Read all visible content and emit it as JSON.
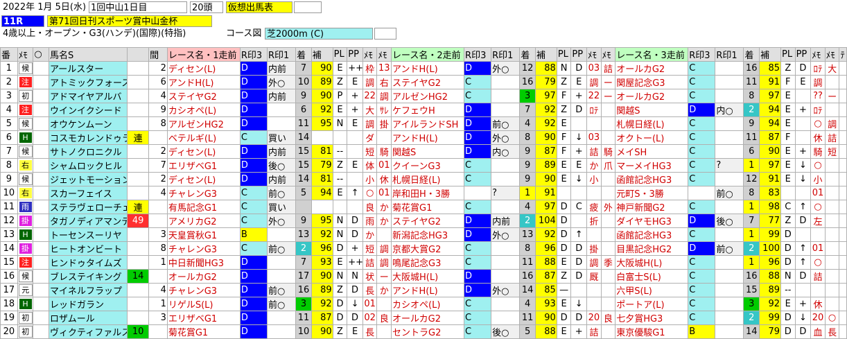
{
  "header": {
    "date": "2022年 1月 5日(水)",
    "meeting": "1回中山1日目",
    "heads": "20頭",
    "doc_type": "仮想出馬表",
    "race_no": "11R",
    "race_name": "第71回日刊スポーツ賞中山金杯",
    "conditions": "4歳以上・オープン・G3(ハンデ)(国際)(特指)",
    "course_label": "コース図",
    "course": "芝2000m (C)"
  },
  "columns": [
    "番",
    "ﾒﾓ",
    "○",
    "馬名S",
    "",
    "間",
    "レース名・1走前",
    "R印3",
    "R印1",
    "着",
    "補",
    "PL",
    "PP",
    "ﾒﾓ",
    "ﾒﾓ",
    "レース名・2走前",
    "R印3",
    "R印1",
    "着",
    "補",
    "PL",
    "PP",
    "ﾒﾓ",
    "ﾒﾓ",
    "レース名・3走前",
    "R印3",
    "R印1",
    "着",
    "補",
    "PL",
    "PP",
    "ﾒﾓ",
    "ﾒﾓ",
    "ﾃ"
  ],
  "rows": [
    {
      "no": "1",
      "mark": "候",
      "name": "アールスター",
      "tag": "",
      "gap": "2",
      "r1": {
        "name": "ディセン(L)",
        "r3": "D",
        "r1": "内前",
        "pos": "7",
        "ho": "90",
        "pl": "E",
        "pp": "++",
        "m1": "枠",
        "m2": "13"
      },
      "r2": {
        "name": "アンドH(L)",
        "r3": "D",
        "r1": "外○",
        "pos": "12",
        "ho": "88",
        "pl": "N",
        "pp": "D",
        "m1": "03",
        "m2": "詰"
      },
      "r3": {
        "name": "オールカG2",
        "r3": "C",
        "r1": "",
        "pos": "16",
        "ho": "85",
        "pl": "Z",
        "pp": "D",
        "m1": "ﾛﾃ",
        "m2": "大"
      }
    },
    {
      "no": "2",
      "mark": "注",
      "name": "アトミックフォース",
      "tag": "",
      "gap": "6",
      "r1": {
        "name": "アンドH(L)",
        "r3": "D",
        "r1": "外○",
        "pos": "10",
        "ho": "89",
        "pl": "Z",
        "pp": "E",
        "m1": "調",
        "m2": "右"
      },
      "r2": {
        "name": "ステイヤG2",
        "r3": "C",
        "r1": "",
        "pos": "16",
        "ho": "79",
        "pl": "Z",
        "pp": "E",
        "m1": "調",
        "m2": "ー"
      },
      "r3": {
        "name": "関屋記念G3",
        "r3": "C",
        "r1": "",
        "pos": "11",
        "ho": "91",
        "pl": "F",
        "pp": "E",
        "m1": "調",
        "m2": ""
      }
    },
    {
      "no": "3",
      "mark": "初",
      "name": "アドマイヤアルバ",
      "tag": "",
      "gap": "4",
      "r1": {
        "name": "ステイヤG2",
        "r3": "D",
        "r1": "内前",
        "pos": "9",
        "ho": "90",
        "pl": "P",
        "pp": "+",
        "m1": "22",
        "m2": "調"
      },
      "r2": {
        "name": "アルゼンHG2",
        "r3": "C",
        "r1": "",
        "pos": "3",
        "ho": "97",
        "pl": "F",
        "pp": "+",
        "m1": "22",
        "m2": "ー"
      },
      "r3": {
        "name": "オールカG2",
        "r3": "C",
        "r1": "",
        "pos": "8",
        "ho": "97",
        "pl": "E",
        "pp": "",
        "m1": "??",
        "m2": "ー"
      }
    },
    {
      "no": "4",
      "mark": "注",
      "name": "ウインイクシード",
      "tag": "",
      "gap": "9",
      "r1": {
        "name": "カシオペ(L)",
        "r3": "D",
        "r1": "",
        "pos": "6",
        "ho": "92",
        "pl": "E",
        "pp": "+",
        "m1": "大",
        "m2": "ｻﾚ"
      },
      "r2": {
        "name": "ケフェウH",
        "r3": "D",
        "r1": "",
        "pos": "7",
        "ho": "92",
        "pl": "Z",
        "pp": "D",
        "m1": "ﾛﾃ",
        "m2": ""
      },
      "r3": {
        "name": "関越S",
        "r3": "D",
        "r1": "内○",
        "pos": "2",
        "ho": "94",
        "pl": "E",
        "pp": "+",
        "m1": "ﾛﾃ",
        "m2": ""
      }
    },
    {
      "no": "5",
      "mark": "候",
      "name": "オウケンムーン",
      "tag": "",
      "gap": "8",
      "r1": {
        "name": "アルゼンHG2",
        "r3": "D",
        "r1": "",
        "pos": "11",
        "ho": "95",
        "pl": "N",
        "pp": "E",
        "m1": "調",
        "m2": "掛"
      },
      "r2": {
        "name": "アイルランドSH",
        "r3": "D",
        "r1": "前○",
        "pos": "4",
        "ho": "92",
        "pl": "E",
        "pp": "",
        "m1": "",
        "m2": ""
      },
      "r3": {
        "name": "札幌日経(L)",
        "r3": "C",
        "r1": "",
        "pos": "9",
        "ho": "94",
        "pl": "E",
        "pp": "",
        "m1": "○",
        "m2": "調"
      }
    },
    {
      "no": "6",
      "mark": "H",
      "name": "コスモカレンドゥラ",
      "tag": "連",
      "gap": "",
      "r1": {
        "name": "ベテルギ(L)",
        "r3": "C",
        "r1": "買い",
        "pos": "14",
        "ho": "",
        "pl": "",
        "pp": "",
        "m1": "ダ",
        "m2": ""
      },
      "r2": {
        "name": "アンドH(L)",
        "r3": "D",
        "r1": "外○",
        "pos": "8",
        "ho": "90",
        "pl": "F",
        "pp": "↓",
        "m1": "03",
        "m2": ""
      },
      "r3": {
        "name": "オクトー(L)",
        "r3": "C",
        "r1": "",
        "pos": "11",
        "ho": "87",
        "pl": "F",
        "pp": "",
        "m1": "休",
        "m2": "詰"
      }
    },
    {
      "no": "7",
      "mark": "候",
      "name": "サトノクロニクル",
      "tag": "",
      "gap": "2",
      "r1": {
        "name": "ディセン(L)",
        "r3": "D",
        "r1": "内前",
        "pos": "15",
        "ho": "81",
        "pl": "--",
        "pp": "",
        "m1": "短",
        "m2": "騎"
      },
      "r2": {
        "name": "関越S",
        "r3": "D",
        "r1": "内○",
        "pos": "9",
        "ho": "87",
        "pl": "F",
        "pp": "+",
        "m1": "詰",
        "m2": "騎"
      },
      "r3": {
        "name": "メイSH",
        "r3": "C",
        "r1": "",
        "pos": "6",
        "ho": "90",
        "pl": "E",
        "pp": "+",
        "m1": "騎",
        "m2": "短"
      }
    },
    {
      "no": "8",
      "mark": "右",
      "name": "シャムロックヒル",
      "tag": "",
      "gap": "7",
      "r1": {
        "name": "エリザベG1",
        "r3": "D",
        "r1": "後○",
        "pos": "15",
        "ho": "79",
        "pl": "Z",
        "pp": "E",
        "m1": "体",
        "m2": "01"
      },
      "r2": {
        "name": "クイーンG3",
        "r3": "C",
        "r1": "",
        "pos": "9",
        "ho": "89",
        "pl": "E",
        "pp": "E",
        "m1": "か",
        "m2": "爪"
      },
      "r3": {
        "name": "マーメイHG3",
        "r3": "C",
        "r1": "?",
        "pos": "1",
        "ho": "97",
        "pl": "E",
        "pp": "↓",
        "m1": "○",
        "m2": ""
      }
    },
    {
      "no": "9",
      "mark": "候",
      "name": "ジェットモーション",
      "tag": "",
      "gap": "2",
      "r1": {
        "name": "ディセン(L)",
        "r3": "D",
        "r1": "内前",
        "pos": "14",
        "ho": "81",
        "pl": "--",
        "pp": "",
        "m1": "小",
        "m2": "休"
      },
      "r2": {
        "name": "札幌日経(L)",
        "r3": "C",
        "r1": "",
        "pos": "9",
        "ho": "90",
        "pl": "E",
        "pp": "↓",
        "m1": "小",
        "m2": ""
      },
      "r3": {
        "name": "函館記念HG3",
        "r3": "C",
        "r1": "",
        "pos": "12",
        "ho": "91",
        "pl": "E",
        "pp": "↓",
        "m1": "小",
        "m2": ""
      }
    },
    {
      "no": "10",
      "mark": "右",
      "name": "スカーフェイス",
      "tag": "",
      "gap": "4",
      "r1": {
        "name": "チャレンG3",
        "r3": "C",
        "r1": "前○",
        "pos": "5",
        "ho": "94",
        "pl": "E",
        "pp": "↑",
        "m1": "○",
        "m2": "01"
      },
      "r2": {
        "name": "岸和田H・3勝",
        "r3": "",
        "r1": "?",
        "pos": "1",
        "ho": "91",
        "pl": "",
        "pp": "",
        "m1": "",
        "m2": ""
      },
      "r3": {
        "name": "元町S・3勝",
        "r3": "",
        "r1": "前○",
        "pos": "8",
        "ho": "83",
        "pl": "",
        "pp": "",
        "m1": "01",
        "m2": ""
      }
    },
    {
      "no": "11",
      "mark": "雨",
      "name": "ステラヴェローチェ",
      "tag": "連",
      "gap": "",
      "r1": {
        "name": "有馬記念G1",
        "r3": "C",
        "r1": "買い",
        "pos": "",
        "ho": "",
        "pl": "",
        "pp": "",
        "m1": "良",
        "m2": "か"
      },
      "r2": {
        "name": "菊花賞G1",
        "r3": "C",
        "r1": "",
        "pos": "4",
        "ho": "97",
        "pl": "D",
        "pp": "C",
        "m1": "疲",
        "m2": "外"
      },
      "r3": {
        "name": "神戸新聞G2",
        "r3": "C",
        "r1": "",
        "pos": "1",
        "ho": "98",
        "pl": "C",
        "pp": "↑",
        "m1": "○",
        "m2": ""
      }
    },
    {
      "no": "12",
      "mark": "掛",
      "name": "タガノディアマンテ",
      "tag": "49",
      "gap": "",
      "r1": {
        "name": "アメリカG2",
        "r3": "C",
        "r1": "外○",
        "pos": "9",
        "ho": "95",
        "pl": "N",
        "pp": "D",
        "m1": "雨",
        "m2": "か"
      },
      "r2": {
        "name": "ステイヤG2",
        "r3": "D",
        "r1": "内前",
        "pos": "2",
        "ho": "104",
        "pl": "D",
        "pp": "",
        "m1": "折",
        "m2": ""
      },
      "r3": {
        "name": "ダイヤモHG3",
        "r3": "D",
        "r1": "後○",
        "pos": "7",
        "ho": "77",
        "pl": "Z",
        "pp": "D",
        "m1": "左",
        "m2": ""
      }
    },
    {
      "no": "13",
      "mark": "H",
      "name": "トーセンスーリヤ",
      "tag": "",
      "gap": "3",
      "r1": {
        "name": "天皇賞秋G1",
        "r3": "B",
        "r1": "",
        "pos": "13",
        "ho": "92",
        "pl": "N",
        "pp": "D",
        "m1": "か",
        "m2": ""
      },
      "r2": {
        "name": "新潟記念HG3",
        "r3": "D",
        "r1": "外○",
        "pos": "13",
        "ho": "92",
        "pl": "D",
        "pp": "↑",
        "m1": "",
        "m2": ""
      },
      "r3": {
        "name": "函館記念HG3",
        "r3": "C",
        "r1": "",
        "pos": "1",
        "ho": "99",
        "pl": "D",
        "pp": "",
        "m1": "",
        "m2": ""
      }
    },
    {
      "no": "14",
      "mark": "掛",
      "name": "ヒートオンビート",
      "tag": "",
      "gap": "8",
      "r1": {
        "name": "チャレンG3",
        "r3": "C",
        "r1": "前○",
        "pos": "2",
        "ho": "96",
        "pl": "D",
        "pp": "+",
        "m1": "短",
        "m2": "調"
      },
      "r2": {
        "name": "京都大賞G2",
        "r3": "C",
        "r1": "",
        "pos": "8",
        "ho": "96",
        "pl": "D",
        "pp": "D",
        "m1": "掛",
        "m2": ""
      },
      "r3": {
        "name": "目黒記念HG2",
        "r3": "D",
        "r1": "前○",
        "pos": "2",
        "ho": "100",
        "pl": "D",
        "pp": "↑",
        "m1": "01",
        "m2": ""
      }
    },
    {
      "no": "15",
      "mark": "注",
      "name": "ヒンドゥタイムズ",
      "tag": "",
      "gap": "1",
      "r1": {
        "name": "中日新聞HG3",
        "r3": "D",
        "r1": "",
        "pos": "7",
        "ho": "93",
        "pl": "E",
        "pp": "++",
        "m1": "詰",
        "m2": "調"
      },
      "r2": {
        "name": "鳴尾記念G3",
        "r3": "C",
        "r1": "",
        "pos": "11",
        "ho": "88",
        "pl": "E",
        "pp": "D",
        "m1": "調",
        "m2": "季"
      },
      "r3": {
        "name": "大阪城H(L)",
        "r3": "C",
        "r1": "",
        "pos": "1",
        "ho": "96",
        "pl": "D",
        "pp": "↑",
        "m1": "○",
        "m2": ""
      }
    },
    {
      "no": "16",
      "mark": "候",
      "name": "ブレステイキング",
      "tag": "14",
      "gap": "",
      "r1": {
        "name": "オールカG2",
        "r3": "D",
        "r1": "",
        "pos": "17",
        "ho": "90",
        "pl": "N",
        "pp": "N",
        "m1": "状",
        "m2": "ー"
      },
      "r2": {
        "name": "大阪城H(L)",
        "r3": "D",
        "r1": "",
        "pos": "16",
        "ho": "87",
        "pl": "Z",
        "pp": "D",
        "m1": "厩",
        "m2": ""
      },
      "r3": {
        "name": "白富士S(L)",
        "r3": "C",
        "r1": "",
        "pos": "16",
        "ho": "88",
        "pl": "N",
        "pp": "D",
        "m1": "詰",
        "m2": ""
      }
    },
    {
      "no": "17",
      "mark": "元",
      "name": "マイネルフラップ",
      "tag": "",
      "gap": "4",
      "r1": {
        "name": "チャレンG3",
        "r3": "D",
        "r1": "前○",
        "pos": "16",
        "ho": "89",
        "pl": "Z",
        "pp": "D",
        "m1": "長",
        "m2": "か"
      },
      "r2": {
        "name": "アンドH(L)",
        "r3": "D",
        "r1": "外○",
        "pos": "14",
        "ho": "85",
        "pl": "—",
        "pp": "",
        "m1": "",
        "m2": ""
      },
      "r3": {
        "name": "六甲S(L)",
        "r3": "C",
        "r1": "",
        "pos": "15",
        "ho": "89",
        "pl": "--",
        "pp": "",
        "m1": "",
        "m2": ""
      }
    },
    {
      "no": "18",
      "mark": "H",
      "name": "レッドガラン",
      "tag": "",
      "gap": "1",
      "r1": {
        "name": "リゲルS(L)",
        "r3": "D",
        "r1": "前○",
        "pos": "3",
        "ho": "92",
        "pl": "D",
        "pp": "↓",
        "m1": "01",
        "m2": ""
      },
      "r2": {
        "name": "カシオペ(L)",
        "r3": "C",
        "r1": "",
        "pos": "4",
        "ho": "93",
        "pl": "E",
        "pp": "↓",
        "m1": "",
        "m2": ""
      },
      "r3": {
        "name": "ポートア(L)",
        "r3": "C",
        "r1": "",
        "pos": "3",
        "ho": "92",
        "pl": "E",
        "pp": "+",
        "m1": "休",
        "m2": ""
      }
    },
    {
      "no": "19",
      "mark": "初",
      "name": "ロザムール",
      "tag": "",
      "gap": "3",
      "r1": {
        "name": "エリザベG1",
        "r3": "D",
        "r1": "",
        "pos": "11",
        "ho": "87",
        "pl": "D",
        "pp": "D",
        "m1": "02",
        "m2": "良"
      },
      "r2": {
        "name": "オールカG2",
        "r3": "C",
        "r1": "",
        "pos": "11",
        "ho": "90",
        "pl": "D",
        "pp": "D",
        "m1": "20",
        "m2": "良"
      },
      "r3": {
        "name": "七夕賞HG3",
        "r3": "C",
        "r1": "",
        "pos": "2",
        "ho": "99",
        "pl": "D",
        "pp": "↓",
        "m1": "20",
        "m2": "○"
      }
    },
    {
      "no": "20",
      "mark": "初",
      "name": "ヴィクティファルス",
      "tag": "10",
      "gap": "",
      "r1": {
        "name": "菊花賞G1",
        "r3": "D",
        "r1": "",
        "pos": "10",
        "ho": "90",
        "pl": "Z",
        "pp": "E",
        "m1": "長",
        "m2": ""
      },
      "r2": {
        "name": "セントラG2",
        "r3": "C",
        "r1": "後○",
        "pos": "5",
        "ho": "88",
        "pl": "E",
        "pp": "+",
        "m1": "詰",
        "m2": ""
      },
      "r3": {
        "name": "東京優駿G1",
        "r3": "B",
        "r1": "",
        "pos": "14",
        "ho": "79",
        "pl": "D",
        "pp": "D",
        "m1": "血",
        "m2": "長"
      }
    }
  ]
}
